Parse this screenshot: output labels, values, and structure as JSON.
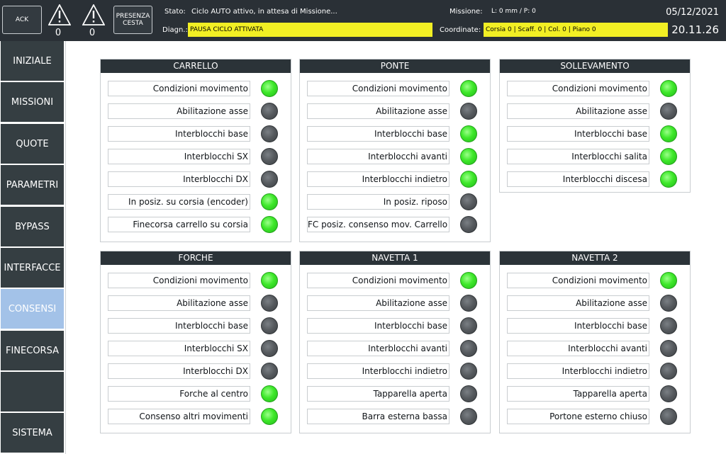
{
  "topbar": {
    "ack_label": "ACK",
    "warning1_count": "0",
    "warning2_count": "0",
    "presenza_label": "PRESENZA CESTA",
    "stato_label": "Stato:",
    "stato_value": "Ciclo AUTO attivo, in attesa di Missione...",
    "diagn_label": "Diagn.:",
    "diagn_value": "PAUSA CICLO ATTIVATA",
    "missione_label": "Missione:",
    "missione_value": "L: 0 mm / P: 0",
    "coordinate_label": "Coordinate:",
    "coordinate_value": "Corsia 0 | Scaff. 0 | Col. 0 | Piano 0",
    "date": "05/12/2021",
    "time": "20.11.26",
    "colors": {
      "highlight": "#f2ef24",
      "bar": "#2a3036"
    }
  },
  "sidebar": {
    "items": [
      {
        "label": "INIZIALE",
        "active": false
      },
      {
        "label": "MISSIONI",
        "active": false
      },
      {
        "label": "QUOTE",
        "active": false
      },
      {
        "label": "PARAMETRI",
        "active": false
      },
      {
        "label": "BYPASS",
        "active": false
      },
      {
        "label": "INTERFACCE",
        "active": false
      },
      {
        "label": "CONSENSI",
        "active": true
      },
      {
        "label": "FINECORSA",
        "active": false
      },
      {
        "label": "",
        "active": false
      },
      {
        "label": "SISTEMA",
        "active": false
      }
    ],
    "colors": {
      "normal": "#353e42",
      "active": "#a3c2e8"
    }
  },
  "panels": [
    {
      "title": "CARRELLO",
      "rows": [
        {
          "label": "Condizioni movimento",
          "on": true
        },
        {
          "label": "Abilitazione asse",
          "on": false
        },
        {
          "label": "Interblocchi base",
          "on": false
        },
        {
          "label": "Interblocchi SX",
          "on": false
        },
        {
          "label": "Interblocchi DX",
          "on": false
        },
        {
          "label": "In posiz. su corsia (encoder)",
          "on": true
        },
        {
          "label": "Finecorsa carrello su corsia",
          "on": true
        }
      ]
    },
    {
      "title": "PONTE",
      "rows": [
        {
          "label": "Condizioni movimento",
          "on": true
        },
        {
          "label": "Abilitazione asse",
          "on": false
        },
        {
          "label": "Interblocchi base",
          "on": true
        },
        {
          "label": "Interblocchi avanti",
          "on": true
        },
        {
          "label": "Interblocchi indietro",
          "on": true
        },
        {
          "label": "In posiz. riposo",
          "on": false
        },
        {
          "label": "FC posiz. consenso mov. Carrello",
          "on": false
        }
      ]
    },
    {
      "title": "SOLLEVAMENTO",
      "rows": [
        {
          "label": "Condizioni movimento",
          "on": true
        },
        {
          "label": "Abilitazione asse",
          "on": false
        },
        {
          "label": "Interblocchi base",
          "on": true
        },
        {
          "label": "Interblocchi salita",
          "on": true
        },
        {
          "label": "Interblocchi discesa",
          "on": true
        }
      ]
    },
    {
      "title": "FORCHE",
      "rows": [
        {
          "label": "Condizioni movimento",
          "on": true
        },
        {
          "label": "Abilitazione asse",
          "on": false
        },
        {
          "label": "Interblocchi base",
          "on": false
        },
        {
          "label": "Interblocchi SX",
          "on": false
        },
        {
          "label": "Interblocchi DX",
          "on": false
        },
        {
          "label": "Forche al centro",
          "on": true
        },
        {
          "label": "Consenso altri movimenti",
          "on": true
        }
      ]
    },
    {
      "title": "NAVETTA 1",
      "rows": [
        {
          "label": "Condizioni movimento",
          "on": true
        },
        {
          "label": "Abilitazione asse",
          "on": false
        },
        {
          "label": "Interblocchi base",
          "on": false
        },
        {
          "label": "Interblocchi avanti",
          "on": false
        },
        {
          "label": "Interblocchi indietro",
          "on": false
        },
        {
          "label": "Tapparella aperta",
          "on": false
        },
        {
          "label": "Barra esterna bassa",
          "on": false
        }
      ]
    },
    {
      "title": "NAVETTA 2",
      "rows": [
        {
          "label": "Condizioni movimento",
          "on": true
        },
        {
          "label": "Abilitazione asse",
          "on": false
        },
        {
          "label": "Interblocchi base",
          "on": false
        },
        {
          "label": "Interblocchi avanti",
          "on": false
        },
        {
          "label": "Interblocchi indietro",
          "on": false
        },
        {
          "label": "Tapparella aperta",
          "on": false
        },
        {
          "label": "Portone esterno chiuso",
          "on": false
        }
      ]
    }
  ],
  "led_colors": {
    "on": "#3ee82a",
    "off": "#55595d"
  }
}
